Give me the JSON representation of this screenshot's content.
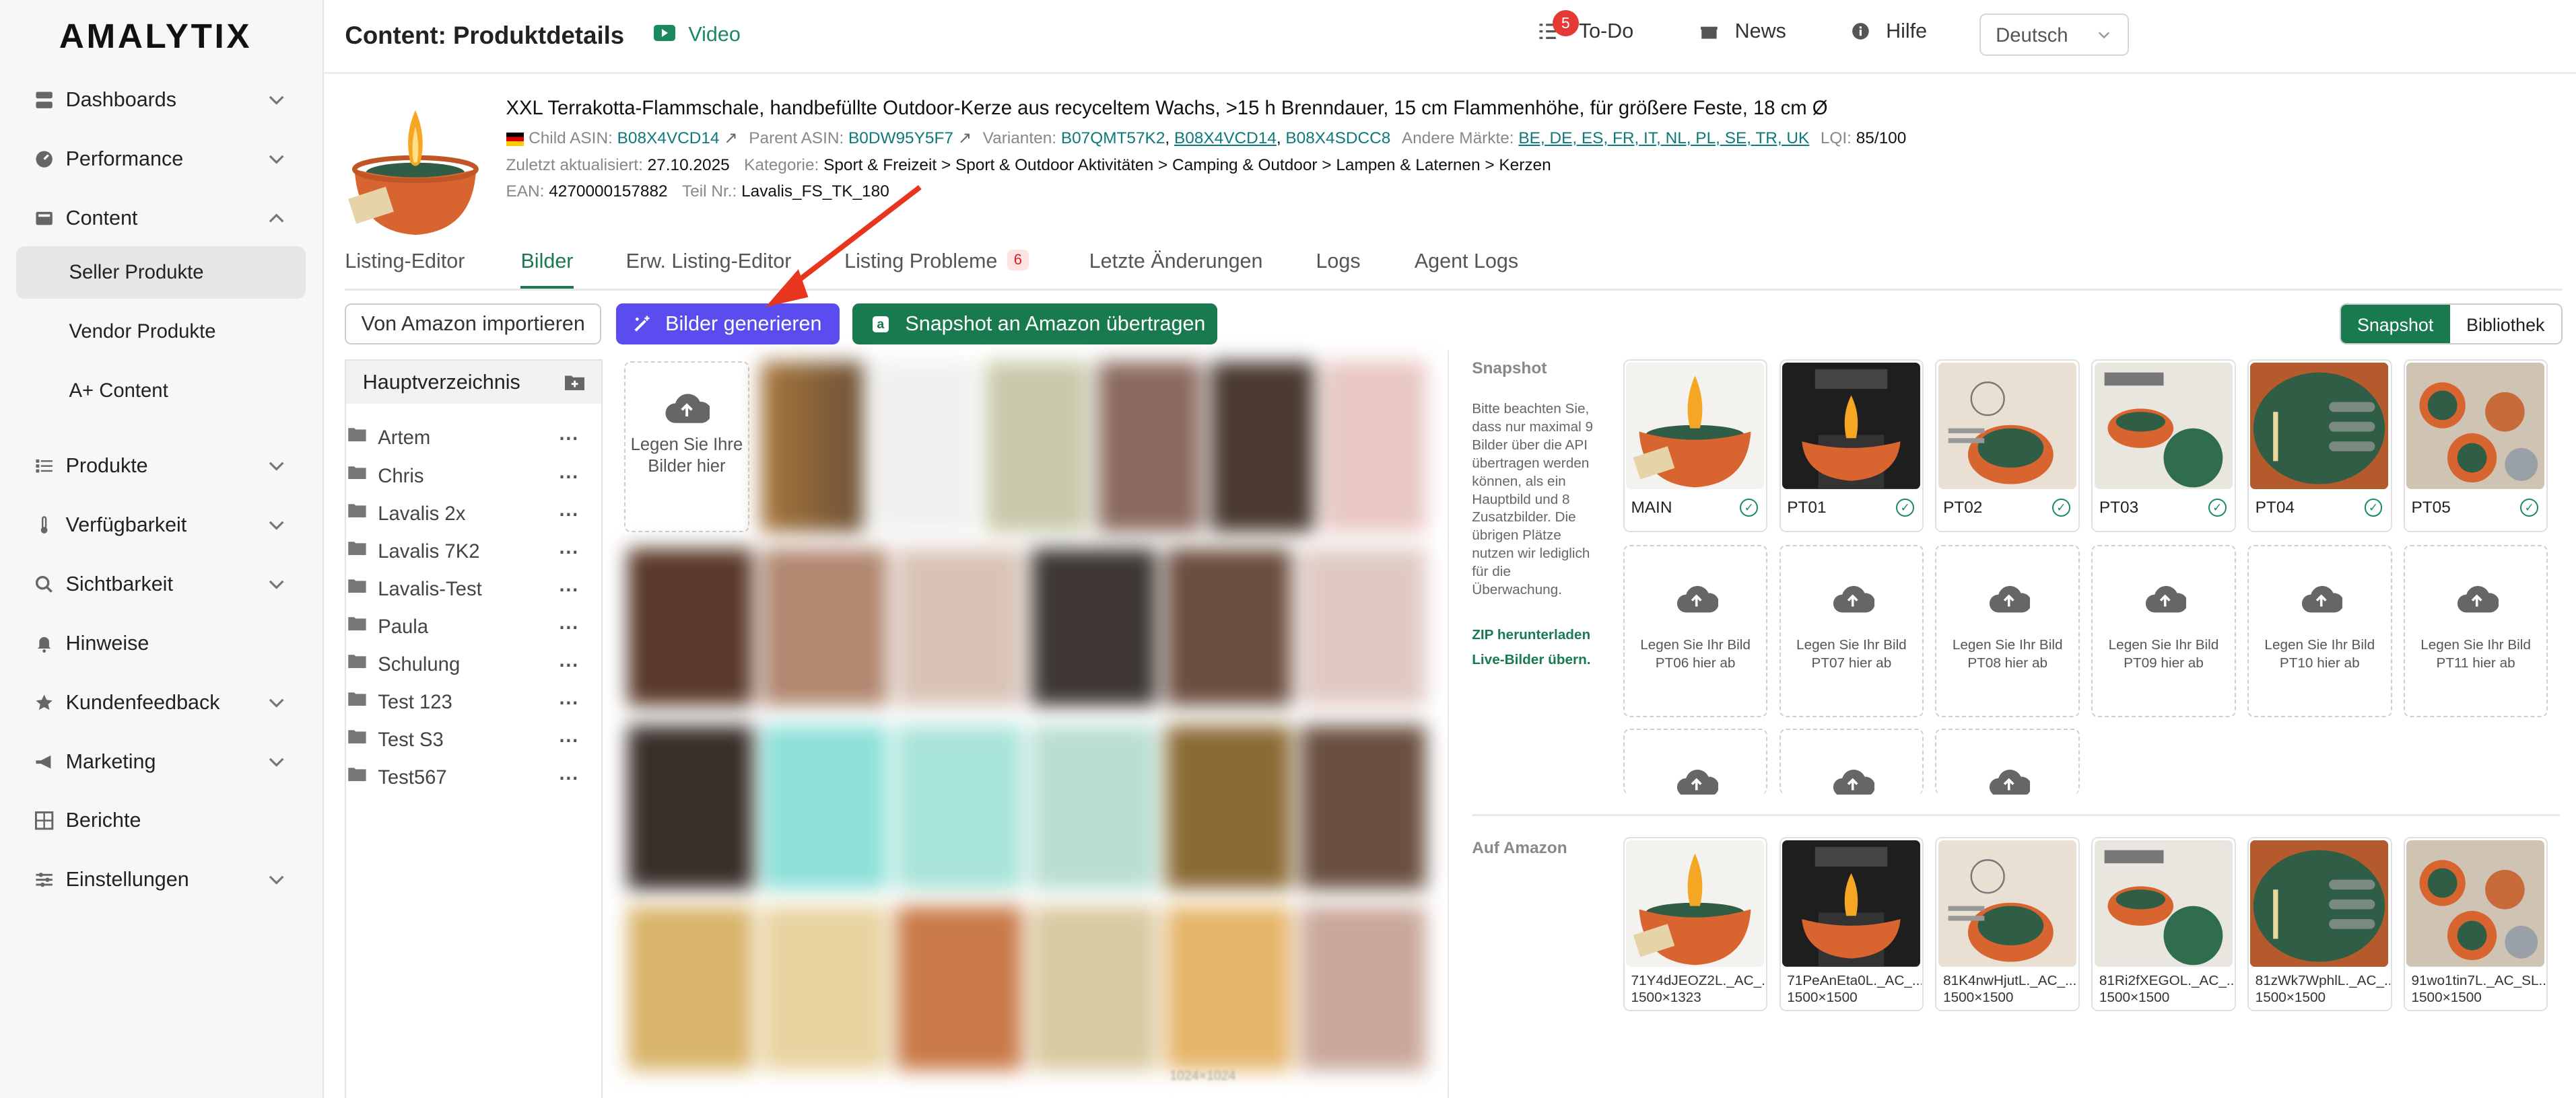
{
  "app": {
    "logo": "AMALYTIX",
    "page_title": "Content: Produktdetails",
    "video_label": "Video",
    "todo_label": "To-Do",
    "todo_count": "5",
    "news_label": "News",
    "help_label": "Hilfe",
    "language": "Deutsch"
  },
  "sidebar": {
    "items": [
      {
        "label": "Dashboards",
        "icon": "dashboard-icon"
      },
      {
        "label": "Performance",
        "icon": "performance-icon"
      },
      {
        "label": "Content",
        "icon": "content-icon"
      },
      {
        "label": "Seller Produkte"
      },
      {
        "label": "Vendor Produkte"
      },
      {
        "label": "A+ Content"
      },
      {
        "label": "Produkte",
        "icon": "list-icon"
      },
      {
        "label": "Verfügbarkeit",
        "icon": "thermometer-icon"
      },
      {
        "label": "Sichtbarkeit",
        "icon": "search-icon"
      },
      {
        "label": "Hinweise",
        "icon": "bell-icon"
      },
      {
        "label": "Kundenfeedback",
        "icon": "star-icon"
      },
      {
        "label": "Marketing",
        "icon": "megaphone-icon"
      },
      {
        "label": "Berichte",
        "icon": "grid-icon"
      },
      {
        "label": "Einstellungen",
        "icon": "sliders-icon"
      }
    ]
  },
  "product": {
    "title": "XXL Terrakotta-Flammschale, handbefüllte Outdoor-Kerze aus recyceltem Wachs, >15 h Brenndauer, 15 cm Flammenhöhe, für größere Feste, 18 cm Ø",
    "child_asin_label": "Child ASIN:",
    "child_asin": "B08X4VCD14",
    "parent_asin_label": "Parent ASIN:",
    "parent_asin": "B0DW95Y5F7",
    "variants_label": "Varianten:",
    "variants": [
      "B07QMT57K2",
      "B08X4VCD14",
      "B08X4SDCC8"
    ],
    "markets_label": "Andere Märkte:",
    "markets": "BE, DE, ES, FR, IT, NL, PL, SE, TR, UK",
    "lqi_label": "LQI:",
    "lqi": "85/100",
    "updated_label": "Zuletzt aktualisiert:",
    "updated": "27.10.2025",
    "category_label": "Kategorie:",
    "category": "Sport & Freizeit > Sport & Outdoor Aktivitäten > Camping & Outdoor > Lampen & Laternen > Kerzen",
    "ean_label": "EAN:",
    "ean": "4270000157882",
    "part_label": "Teil Nr.:",
    "part": "Lavalis_FS_TK_180"
  },
  "tabs": [
    {
      "label": "Listing-Editor"
    },
    {
      "label": "Bilder"
    },
    {
      "label": "Erw. Listing-Editor"
    },
    {
      "label": "Listing Probleme",
      "badge": "6"
    },
    {
      "label": "Letzte Änderungen"
    },
    {
      "label": "Logs"
    },
    {
      "label": "Agent Logs"
    }
  ],
  "toolbar": {
    "import_label": "Von Amazon importieren",
    "generate_label": "Bilder generieren",
    "snapshot_label": "Snapshot an Amazon übertragen",
    "toggle_snapshot": "Snapshot",
    "toggle_library": "Bibliothek"
  },
  "folders": {
    "root": "Hauptverzeichnis",
    "items": [
      "Artem",
      "Chris",
      "Lavalis 2x",
      "Lavalis 7K2",
      "Lavalis-Test",
      "Paula",
      "Schulung",
      "Test 123",
      "Test S3",
      "Test567"
    ]
  },
  "library": {
    "drop_text": "Legen Sie Ihre Bilder hier",
    "footer_dim": "1024×1024"
  },
  "snapshot": {
    "label": "Snapshot",
    "note": "Bitte beachten Sie, dass nur maximal 9 Bilder über die API übertragen werden können, als ein Hauptbild und 8 Zusatzbilder. Die übrigen Plätze nutzen wir lediglich für die Überwachung.",
    "zip_link": "ZIP herunterladen",
    "live_link": "Live-Bilder übern.",
    "slots": [
      "MAIN",
      "PT01",
      "PT02",
      "PT03",
      "PT04",
      "PT05"
    ],
    "drop_slots": [
      "Legen Sie Ihr Bild PT06 hier ab",
      "Legen Sie Ihr Bild PT07 hier ab",
      "Legen Sie Ihr Bild PT08 hier ab",
      "Legen Sie Ihr Bild PT09 hier ab",
      "Legen Sie Ihr Bild PT10 hier ab",
      "Legen Sie Ihr Bild PT11 hier ab"
    ]
  },
  "amazon": {
    "label": "Auf Amazon",
    "images": [
      {
        "file": "71Y4dJEOZ2L._AC_...",
        "dim": "1500×1323"
      },
      {
        "file": "71PeAnEta0L._AC_...",
        "dim": "1500×1500"
      },
      {
        "file": "81K4nwHjutL._AC_...",
        "dim": "1500×1500"
      },
      {
        "file": "81Ri2fXEGOL._AC_...",
        "dim": "1500×1500"
      },
      {
        "file": "81zWk7WphlL._AC_...",
        "dim": "1500×1500"
      },
      {
        "file": "91wo1tin7L._AC_SL...",
        "dim": "1500×1500"
      }
    ]
  }
}
